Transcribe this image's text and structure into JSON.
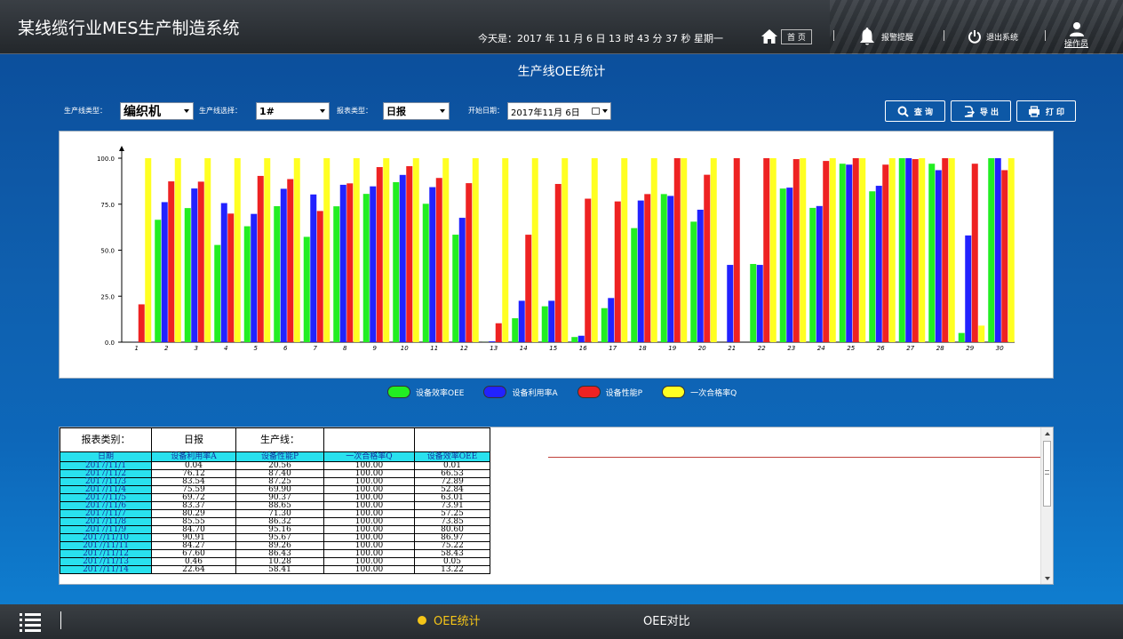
{
  "header": {
    "app_title": "某线缆行业MES生产制造系统",
    "date_text": "今天是：2017 年 11 月 6 日  13 时 43 分 37 秒   星期一",
    "home_label": "首 页",
    "alarm_label": "报警提醒",
    "logout_label": "退出系统",
    "user_label": "操作员"
  },
  "page": {
    "title": "生产线OEE统计"
  },
  "filters": {
    "line_type_label": "生产线类型：",
    "line_type_value": "编织机",
    "line_select_label": "生产线选择：",
    "line_select_value": "1#",
    "report_type_label": "报表类型：",
    "report_type_value": "日报",
    "start_date_label": "开始日期：",
    "start_date_value": "2017年11月  6日"
  },
  "actions": {
    "query": "查 询",
    "export": "导 出",
    "print": "打 印"
  },
  "colors": {
    "oee": "#22ee22",
    "availability": "#2222ff",
    "performance": "#ee2222",
    "quality": "#ffff22",
    "cyan": "#29e1ee"
  },
  "chart_data": {
    "type": "bar",
    "categories": [
      "1",
      "2",
      "3",
      "4",
      "5",
      "6",
      "7",
      "8",
      "9",
      "10",
      "11",
      "12",
      "13",
      "14",
      "15",
      "16",
      "17",
      "18",
      "19",
      "20",
      "21",
      "22",
      "23",
      "24",
      "25",
      "26",
      "27",
      "28",
      "29",
      "30"
    ],
    "ylim": [
      0,
      100
    ],
    "yticks": [
      0.0,
      25.0,
      50.0,
      75.0,
      100.0
    ],
    "ytick_labels": [
      "0.0",
      "25.0",
      "50.0",
      "75.0",
      "100.0"
    ],
    "series": [
      {
        "name": "设备效率OEE",
        "color": "#22ee22",
        "values": [
          0.01,
          66.53,
          72.89,
          52.84,
          63.01,
          73.91,
          57.25,
          73.85,
          80.6,
          86.97,
          75.22,
          58.43,
          0.05,
          13.0,
          19.5,
          2.8,
          18.5,
          62.0,
          80.5,
          65.5,
          0,
          42.5,
          83.5,
          73.0,
          97.0,
          82.0,
          100,
          97.0,
          5.0,
          100
        ]
      },
      {
        "name": "设备利用率A",
        "color": "#2222ff",
        "values": [
          0.04,
          76.12,
          83.54,
          75.59,
          69.72,
          83.37,
          80.29,
          85.55,
          84.7,
          90.91,
          84.27,
          67.6,
          0.46,
          22.5,
          22.5,
          3.5,
          24.0,
          77.0,
          79.5,
          72.0,
          42.0,
          42.0,
          84.0,
          74.0,
          96.5,
          85.0,
          100,
          93.5,
          58.0,
          100
        ]
      },
      {
        "name": "设备性能P",
        "color": "#ee2222",
        "values": [
          20.56,
          87.4,
          87.25,
          69.9,
          90.37,
          88.65,
          71.3,
          86.32,
          95.16,
          95.67,
          89.26,
          86.43,
          10.28,
          58.41,
          86.0,
          78.0,
          76.5,
          80.5,
          100,
          91.0,
          100,
          100,
          99.5,
          98.5,
          100,
          96.5,
          99.5,
          100,
          97.0,
          93.5
        ]
      },
      {
        "name": "一次合格率Q",
        "color": "#ffff22",
        "values": [
          100,
          100,
          100,
          100,
          100,
          100,
          100,
          100,
          100,
          100,
          100,
          100,
          100,
          100,
          100,
          100,
          100,
          100,
          100,
          100,
          0,
          100,
          100,
          100,
          100,
          100,
          100,
          100,
          9.0,
          100
        ]
      }
    ]
  },
  "legend": [
    {
      "label": "设备效率OEE",
      "color": "#22ee22"
    },
    {
      "label": "设备利用率A",
      "color": "#2222ff"
    },
    {
      "label": "设备性能P",
      "color": "#ee2222"
    },
    {
      "label": "一次合格率Q",
      "color": "#ffff22"
    }
  ],
  "table": {
    "head1": [
      "报表类别：",
      "日报",
      "生产线：",
      "",
      ""
    ],
    "columns": [
      "日期",
      "设备利用率A",
      "设备性能P",
      "一次合格率Q",
      "设备效率OEE"
    ],
    "rows": [
      [
        "2017/11/1",
        "0.04",
        "20.56",
        "100.00",
        "0.01"
      ],
      [
        "2017/11/2",
        "76.12",
        "87.40",
        "100.00",
        "66.53"
      ],
      [
        "2017/11/3",
        "83.54",
        "87.25",
        "100.00",
        "72.89"
      ],
      [
        "2017/11/4",
        "75.59",
        "69.90",
        "100.00",
        "52.84"
      ],
      [
        "2017/11/5",
        "69.72",
        "90.37",
        "100.00",
        "63.01"
      ],
      [
        "2017/11/6",
        "83.37",
        "88.65",
        "100.00",
        "73.91"
      ],
      [
        "2017/11/7",
        "80.29",
        "71.30",
        "100.00",
        "57.25"
      ],
      [
        "2017/11/8",
        "85.55",
        "86.32",
        "100.00",
        "73.85"
      ],
      [
        "2017/11/9",
        "84.70",
        "95.16",
        "100.00",
        "80.60"
      ],
      [
        "2017/11/10",
        "90.91",
        "95.67",
        "100.00",
        "86.97"
      ],
      [
        "2017/11/11",
        "84.27",
        "89.26",
        "100.00",
        "75.22"
      ],
      [
        "2017/11/12",
        "67.60",
        "86.43",
        "100.00",
        "58.43"
      ],
      [
        "2017/11/13",
        "0.46",
        "10.28",
        "100.00",
        "0.05"
      ],
      [
        "2017/11/14",
        "22.64",
        "58.41",
        "100.00",
        "13.22"
      ]
    ]
  },
  "bottom_nav": {
    "oee_stats": "OEE统计",
    "oee_compare": "OEE对比"
  }
}
